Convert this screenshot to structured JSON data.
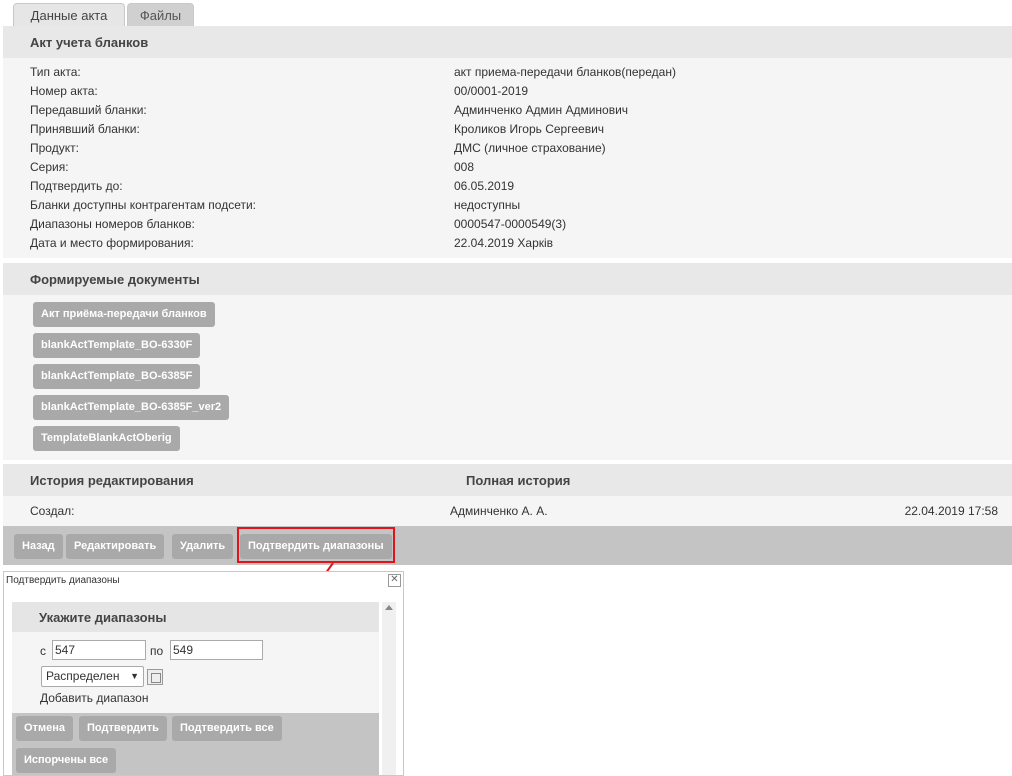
{
  "tabs": [
    {
      "label": "Данные акта"
    },
    {
      "label": "Файлы"
    }
  ],
  "act_section": {
    "title": "Акт учета бланков",
    "rows": [
      {
        "label": "Тип акта:",
        "value": "акт приема-передачи бланков(передан)"
      },
      {
        "label": "Номер акта:",
        "value": "00/0001-2019"
      },
      {
        "label": "Передавший бланки:",
        "value": "Админченко Админ Админович"
      },
      {
        "label": "Принявший бланки:",
        "value": "Кроликов Игорь Сергеевич"
      },
      {
        "label": "Продукт:",
        "value": "ДМС (личное страхование)"
      },
      {
        "label": "Серия:",
        "value": "008"
      },
      {
        "label": "Подтвердить до:",
        "value": "06.05.2019"
      },
      {
        "label": "Бланки доступны контрагентам подсети:",
        "value": "недоступны"
      },
      {
        "label": "Диапазоны номеров бланков:",
        "value": "0000547-0000549(3)"
      },
      {
        "label": "Дата и место формирования:",
        "value": "22.04.2019 Харків"
      }
    ]
  },
  "docs_section": {
    "title": "Формируемые документы",
    "buttons": [
      {
        "label": "Акт приёма-передачи бланков"
      },
      {
        "label": "blankActTemplate_BO-6330F"
      },
      {
        "label": "blankActTemplate_BO-6385F"
      },
      {
        "label": "blankActTemplate_BO-6385F_ver2"
      },
      {
        "label": "TemplateBlankActOberig"
      }
    ]
  },
  "history": {
    "title": "История редактирования",
    "full_link": "Полная история",
    "row": {
      "action": "Создал:",
      "user": "Админченко А. А.",
      "datetime": "22.04.2019 17:58"
    }
  },
  "toolbar": {
    "back": "Назад",
    "edit": "Редактировать",
    "delete": "Удалить",
    "confirm_ranges": "Подтвердить диапазоны"
  },
  "dialog": {
    "title": "Подтвердить диапазоны",
    "header": "Укажите диапазоны",
    "from_label": "с",
    "from_value": "547",
    "to_label": "по",
    "to_value": "549",
    "select_value": "Распределен",
    "add_range": "Добавить диапазон",
    "buttons": {
      "cancel": "Отмена",
      "confirm": "Подтвердить",
      "confirm_all": "Подтвердить все",
      "spoiled_all": "Испорчены все"
    }
  },
  "colors": {
    "highlight": "#e0151b",
    "button_gray": "#a9a9a9",
    "band": "#e8e8e8"
  }
}
